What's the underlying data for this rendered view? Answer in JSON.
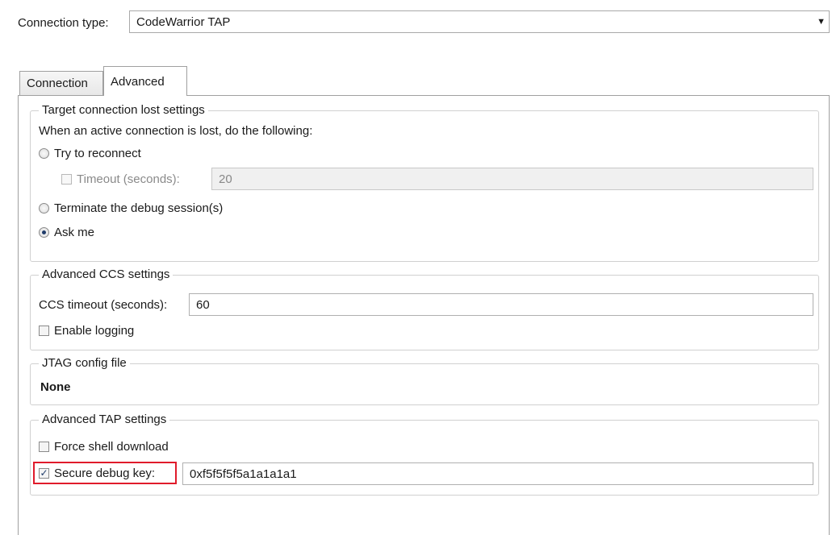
{
  "connection": {
    "label": "Connection type:",
    "value": "CodeWarrior TAP",
    "arrow": "▼"
  },
  "tabs": [
    {
      "label": "Connection"
    },
    {
      "label": "Advanced"
    }
  ],
  "lost": {
    "legend": "Target connection lost settings",
    "description": "When an active connection is lost, do the following:",
    "reconnect_label": "Try to reconnect",
    "timeout_label": "Timeout (seconds):",
    "timeout_value": "20",
    "terminate_label": "Terminate the debug session(s)",
    "askme_label": "Ask me"
  },
  "ccs": {
    "legend": "Advanced CCS settings",
    "timeout_label": "CCS timeout (seconds):",
    "timeout_value": "60",
    "logging_label": "Enable logging"
  },
  "jtag": {
    "legend": "JTAG config file",
    "value": "None"
  },
  "tap": {
    "legend": "Advanced TAP settings",
    "force_label": "Force shell download",
    "secure_label": "Secure debug key:",
    "secure_value": "0xf5f5f5f5a1a1a1a1",
    "secure_checkmark": "✓"
  }
}
